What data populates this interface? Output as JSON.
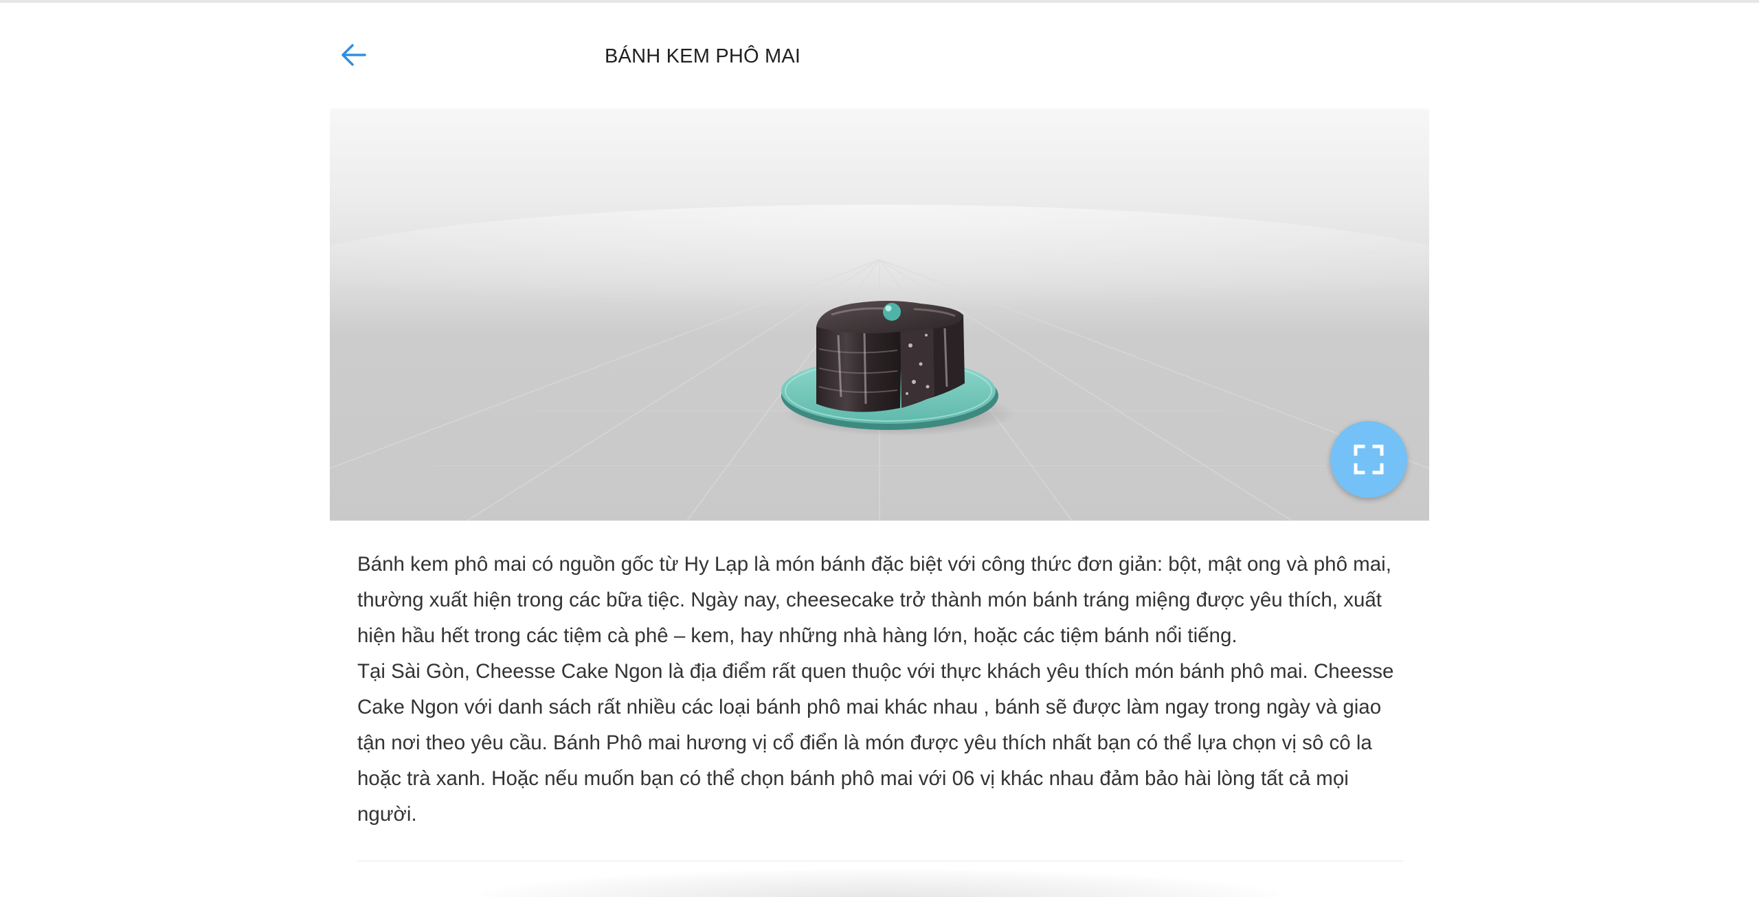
{
  "header": {
    "back_icon": "arrow-left-icon",
    "title": "BÁNH KEM PHÔ MAI"
  },
  "viewer": {
    "model": "chocolate-cake-on-plate",
    "fullscreen_icon": "fullscreen-icon",
    "accent_color": "#74c1f7"
  },
  "description": {
    "paragraphs": [
      "Bánh kem phô mai có nguồn gốc từ Hy Lạp là món bánh đặc biệt với công thức đơn giản: bột, mật ong và phô mai, thường xuất hiện trong các bữa tiệc. Ngày nay, cheesecake trở thành món bánh tráng miệng được yêu thích, xuất hiện hầu hết trong các tiệm cà phê – kem, hay những nhà hàng lớn, hoặc các tiệm bánh nổi tiếng.",
      "Tại Sài Gòn, Cheesse Cake Ngon là địa điểm rất quen thuộc với thực khách yêu thích món bánh phô mai. Cheesse Cake Ngon với danh sách rất nhiều các loại bánh phô mai khác nhau , bánh sẽ được làm ngay trong ngày và giao tận nơi theo yêu cầu. Bánh Phô mai hương vị cổ điển là món được yêu thích nhất bạn có thể lựa chọn vị sô cô la hoặc trà xanh. Hoặc nếu muốn bạn có thể chọn bánh phô mai với 06 vị khác nhau đảm bảo hài lòng tất cả mọi người."
    ]
  }
}
